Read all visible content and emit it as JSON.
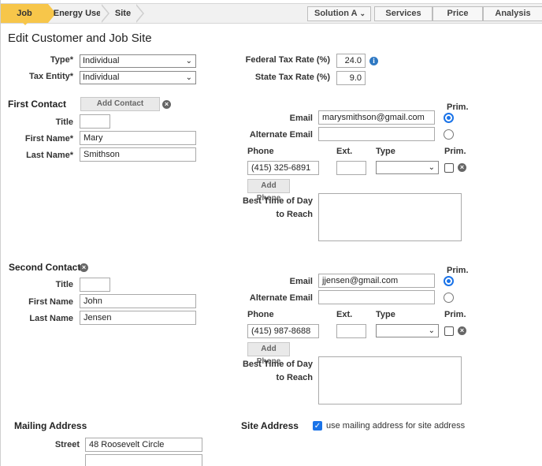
{
  "topbar": {
    "crumbs": [
      "Job",
      "Energy Use",
      "Site"
    ],
    "solution_label": "Solution A",
    "nav": [
      "Services",
      "Price",
      "Analysis"
    ]
  },
  "page_title": "Edit Customer and Job Site",
  "customer": {
    "type_label": "Type*",
    "type_value": "Individual",
    "tax_entity_label": "Tax Entity*",
    "tax_entity_value": "Individual"
  },
  "tax": {
    "federal_label": "Federal Tax Rate (%)",
    "federal_value": "24.0",
    "state_label": "State Tax Rate (%)",
    "state_value": "9.0"
  },
  "first_contact": {
    "heading": "First Contact",
    "add_contact_label": "Add Contact",
    "title_label": "Title",
    "title_value": "",
    "first_name_label": "First Name*",
    "first_name_value": "Mary",
    "last_name_label": "Last Name*",
    "last_name_value": "Smithson",
    "prim_label": "Prim.",
    "email_label": "Email",
    "email_value": "marysmithson@gmail.com",
    "alt_email_label": "Alternate Email",
    "alt_email_value": "",
    "phone_label": "Phone",
    "ext_label": "Ext.",
    "type_label": "Type",
    "phone_prim_label": "Prim.",
    "phone_value": "(415) 325-6891",
    "ext_value": "",
    "add_phone_label": "Add Phone",
    "best_time_line1": "Best Time of Day",
    "best_time_line2": "to Reach"
  },
  "second_contact": {
    "heading": "Second Contact",
    "title_label": "Title",
    "title_value": "",
    "first_name_label": "First Name",
    "first_name_value": "John",
    "last_name_label": "Last Name",
    "last_name_value": "Jensen",
    "prim_label": "Prim.",
    "email_label": "Email",
    "email_value": "jjensen@gmail.com",
    "alt_email_label": "Alternate Email",
    "alt_email_value": "",
    "phone_label": "Phone",
    "ext_label": "Ext.",
    "type_label": "Type",
    "phone_prim_label": "Prim.",
    "phone_value": "(415) 987-8688",
    "ext_value": "",
    "add_phone_label": "Add Phone",
    "best_time_line1": "Best Time of Day",
    "best_time_line2": "to Reach"
  },
  "mailing": {
    "heading": "Mailing Address",
    "street_label": "Street",
    "street_value": "48 Roosevelt Circle",
    "street2_value": ""
  },
  "site": {
    "heading": "Site Address",
    "use_mailing_label": "use mailing address for site address"
  },
  "icons": {
    "remove": "×",
    "info": "i",
    "caret": "⌄",
    "check": "✓"
  }
}
